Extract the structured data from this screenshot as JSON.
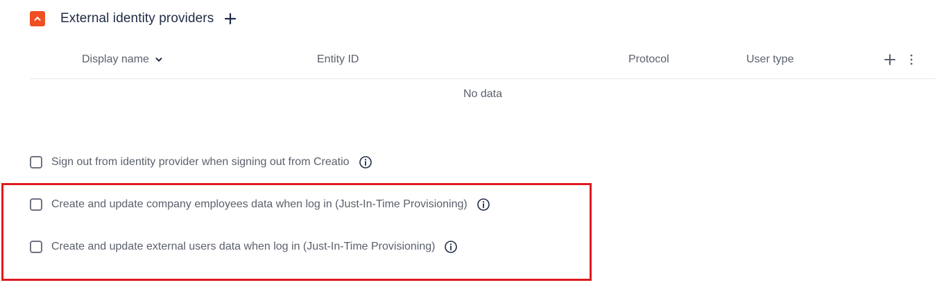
{
  "section": {
    "title": "External identity providers",
    "accent_color": "#f04e23"
  },
  "table": {
    "columns": [
      "Display name",
      "Entity ID",
      "Protocol",
      "User type"
    ],
    "sorted_by": "Display name",
    "empty_message": "No data"
  },
  "options": [
    {
      "label": "Sign out from identity provider when signing out from Creatio",
      "checked": false
    },
    {
      "label": "Create and update company employees data when log in (Just-In-Time Provisioning)",
      "checked": false
    },
    {
      "label": "Create and update external users data when log in (Just-In-Time Provisioning)",
      "checked": false
    }
  ],
  "highlight_color": "#e0181e",
  "icons": {
    "collapse": "chevron-up-icon",
    "add": "plus-icon",
    "sort": "chevron-down-icon",
    "more": "more-vertical-icon",
    "info": "info-icon"
  }
}
